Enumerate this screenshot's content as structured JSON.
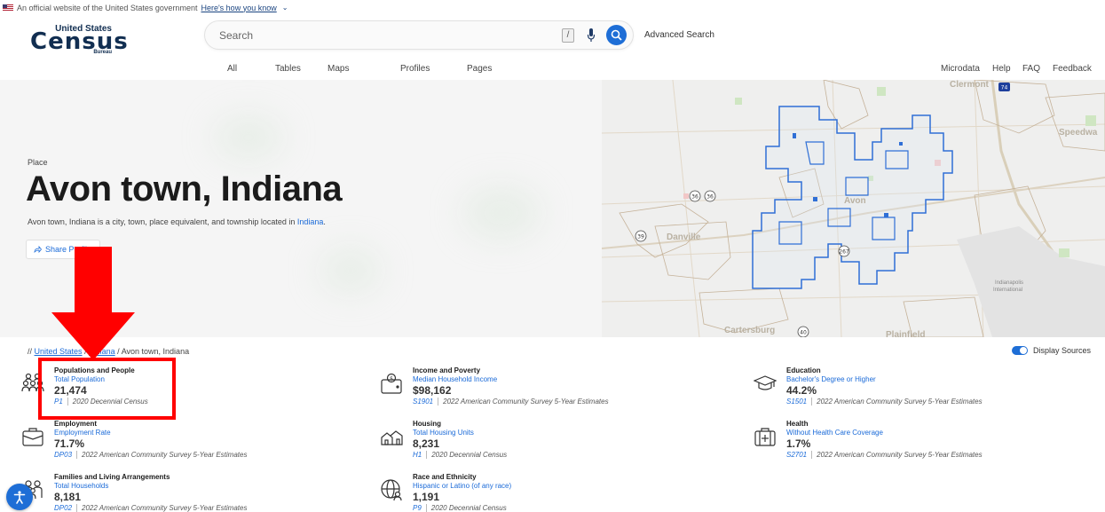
{
  "banner": {
    "text": "An official website of the United States government",
    "link": "Here's how you know"
  },
  "logo": {
    "top": "United States",
    "main": "Census",
    "bottom": "Bureau"
  },
  "search": {
    "placeholder": "Search",
    "shortcut": "/",
    "advanced": "Advanced Search"
  },
  "nav": {
    "tabs": [
      "All",
      "Tables",
      "Maps",
      "Profiles",
      "Pages"
    ]
  },
  "header_links": [
    "Microdata",
    "Help",
    "FAQ",
    "Feedback"
  ],
  "profile": {
    "kind": "Place",
    "title": "Avon town, Indiana",
    "description_prefix": "Avon town, Indiana is a city, town, place equivalent, and township located in ",
    "description_link": "Indiana",
    "description_suffix": ".",
    "share_label": "Share Profile"
  },
  "map_labels": {
    "clermont": "Clermont",
    "speedway": "Speedwa",
    "avon": "Avon",
    "danville": "Danville",
    "cartersburg": "Cartersburg",
    "plainfield": "Plainfield",
    "airport_line1": "Indianapolis",
    "airport_line2": "International",
    "route_74": "74",
    "route_36a": "36",
    "route_36b": "36",
    "route_39": "39",
    "route_267": "267",
    "route_40": "40"
  },
  "breadcrumb": {
    "prefix": "//",
    "items": [
      "United States",
      "Indiana",
      "Avon town, Indiana"
    ]
  },
  "display_sources": "Display Sources",
  "cards": [
    {
      "category": "Populations and People",
      "metric": "Total Population",
      "value": "21,474",
      "table": "P1",
      "source": "2020 Decennial Census",
      "icon": "people-icon"
    },
    {
      "category": "Income and Poverty",
      "metric": "Median Household Income",
      "value": "$98,162",
      "table": "S1901",
      "source": "2022 American Community Survey 5-Year Estimates",
      "icon": "wallet-icon"
    },
    {
      "category": "Education",
      "metric": "Bachelor's Degree or Higher",
      "value": "44.2%",
      "table": "S1501",
      "source": "2022 American Community Survey 5-Year Estimates",
      "icon": "graduation-cap-icon"
    },
    {
      "category": "Employment",
      "metric": "Employment Rate",
      "value": "71.7%",
      "table": "DP03",
      "source": "2022 American Community Survey 5-Year Estimates",
      "icon": "briefcase-icon"
    },
    {
      "category": "Housing",
      "metric": "Total Housing Units",
      "value": "8,231",
      "table": "H1",
      "source": "2020 Decennial Census",
      "icon": "houses-icon"
    },
    {
      "category": "Health",
      "metric": "Without Health Care Coverage",
      "value": "1.7%",
      "table": "S2701",
      "source": "2022 American Community Survey 5-Year Estimates",
      "icon": "medical-kit-icon"
    },
    {
      "category": "Families and Living Arrangements",
      "metric": "Total Households",
      "value": "8,181",
      "table": "DP02",
      "source": "2022 American Community Survey 5-Year Estimates",
      "icon": "family-icon"
    },
    {
      "category": "Race and Ethnicity",
      "metric": "Hispanic or Latino (of any race)",
      "value": "1,191",
      "table": "P9",
      "source": "2020 Decennial Census",
      "icon": "globe-people-icon"
    }
  ],
  "colors": {
    "accent": "#1e6ed6",
    "annotation": "#ff0000",
    "boundary": "#2f6fd6"
  }
}
